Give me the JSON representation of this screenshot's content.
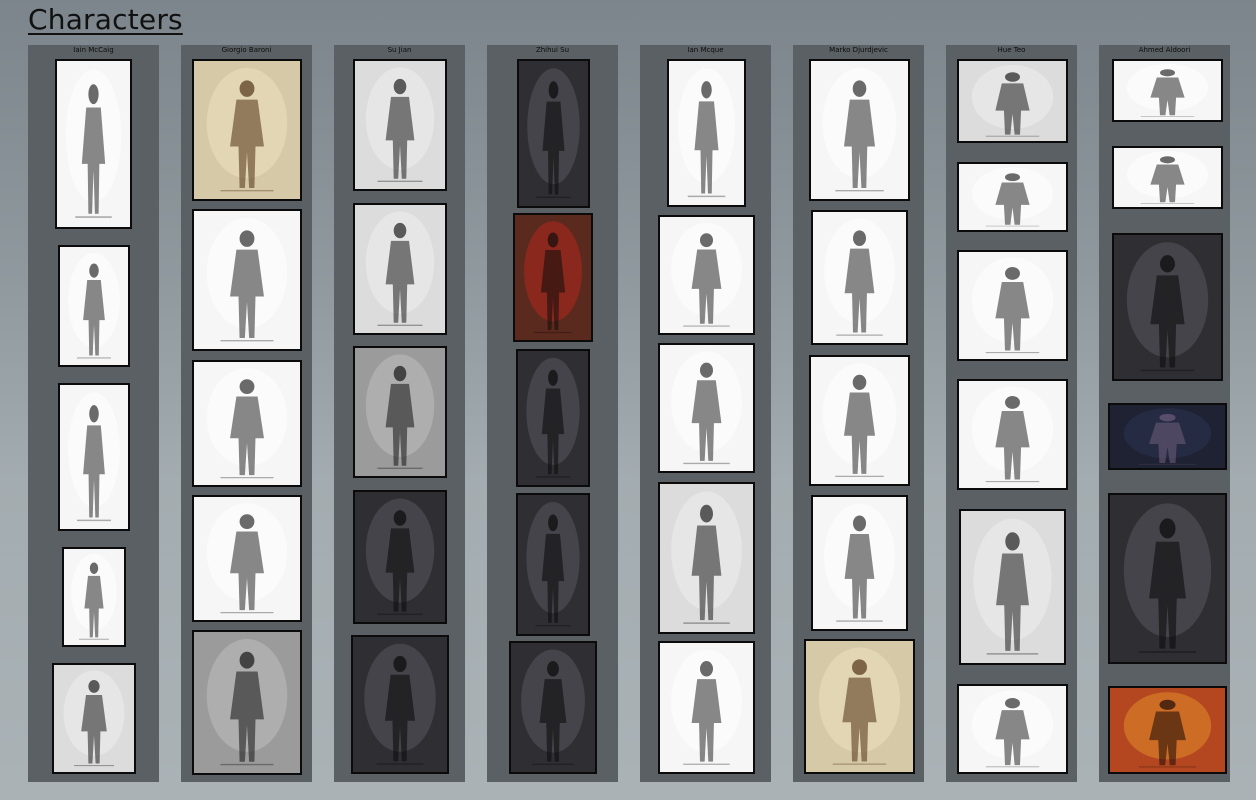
{
  "page": {
    "title": "Characters"
  },
  "artists": [
    {
      "name": "Iain McCaig",
      "col": "c1",
      "thumbs": [
        {
          "id": "c1t1",
          "tone": "white"
        },
        {
          "id": "c1t2",
          "tone": "white"
        },
        {
          "id": "c1t3",
          "tone": "white"
        },
        {
          "id": "c1t4",
          "tone": "white"
        },
        {
          "id": "c1t5",
          "tone": "light"
        }
      ]
    },
    {
      "name": "Giorgio Baroni",
      "col": "c2",
      "thumbs": [
        {
          "id": "c2t1",
          "tone": "sepia"
        },
        {
          "id": "c2t2",
          "tone": "white"
        },
        {
          "id": "c2t3",
          "tone": "white"
        },
        {
          "id": "c2t4",
          "tone": "white"
        },
        {
          "id": "c2t5",
          "tone": "mid"
        }
      ]
    },
    {
      "name": "Su Jian",
      "col": "c3",
      "thumbs": [
        {
          "id": "c3t1",
          "tone": "light"
        },
        {
          "id": "c3t2",
          "tone": "light"
        },
        {
          "id": "c3t3",
          "tone": "mid"
        },
        {
          "id": "c3t4",
          "tone": "dark"
        },
        {
          "id": "c3t5",
          "tone": "dark"
        }
      ]
    },
    {
      "name": "Zhihui Su",
      "col": "c4",
      "thumbs": [
        {
          "id": "c4t1",
          "tone": "dark"
        },
        {
          "id": "c4t2",
          "tone": "red"
        },
        {
          "id": "c4t3",
          "tone": "dark"
        },
        {
          "id": "c4t4",
          "tone": "dark"
        },
        {
          "id": "c4t5",
          "tone": "dark"
        }
      ]
    },
    {
      "name": "Ian Mcque",
      "col": "c5",
      "thumbs": [
        {
          "id": "c5t1",
          "tone": "white"
        },
        {
          "id": "c5t2",
          "tone": "white"
        },
        {
          "id": "c5t3",
          "tone": "white"
        },
        {
          "id": "c5t4",
          "tone": "light"
        },
        {
          "id": "c5t5",
          "tone": "white"
        }
      ]
    },
    {
      "name": "Marko Djurdjevic",
      "col": "c6",
      "thumbs": [
        {
          "id": "c6t1",
          "tone": "white"
        },
        {
          "id": "c6t2",
          "tone": "white"
        },
        {
          "id": "c6t3",
          "tone": "white"
        },
        {
          "id": "c6t4",
          "tone": "white"
        },
        {
          "id": "c6t5",
          "tone": "sepia"
        }
      ]
    },
    {
      "name": "Hue Teo",
      "col": "c7",
      "thumbs": [
        {
          "id": "c7t1",
          "tone": "light"
        },
        {
          "id": "c7t2",
          "tone": "white"
        },
        {
          "id": "c7t3",
          "tone": "white"
        },
        {
          "id": "c7t4",
          "tone": "white"
        },
        {
          "id": "c7t5",
          "tone": "light"
        },
        {
          "id": "c7t6",
          "tone": "white"
        }
      ]
    },
    {
      "name": "Ahmed Aldoori",
      "col": "c8",
      "thumbs": [
        {
          "id": "c8t1",
          "tone": "white"
        },
        {
          "id": "c8t2",
          "tone": "white"
        },
        {
          "id": "c8t3",
          "tone": "dark"
        },
        {
          "id": "c8t4",
          "tone": "navy"
        },
        {
          "id": "c8t5",
          "tone": "dark"
        },
        {
          "id": "c8t6",
          "tone": "warm"
        }
      ]
    }
  ]
}
